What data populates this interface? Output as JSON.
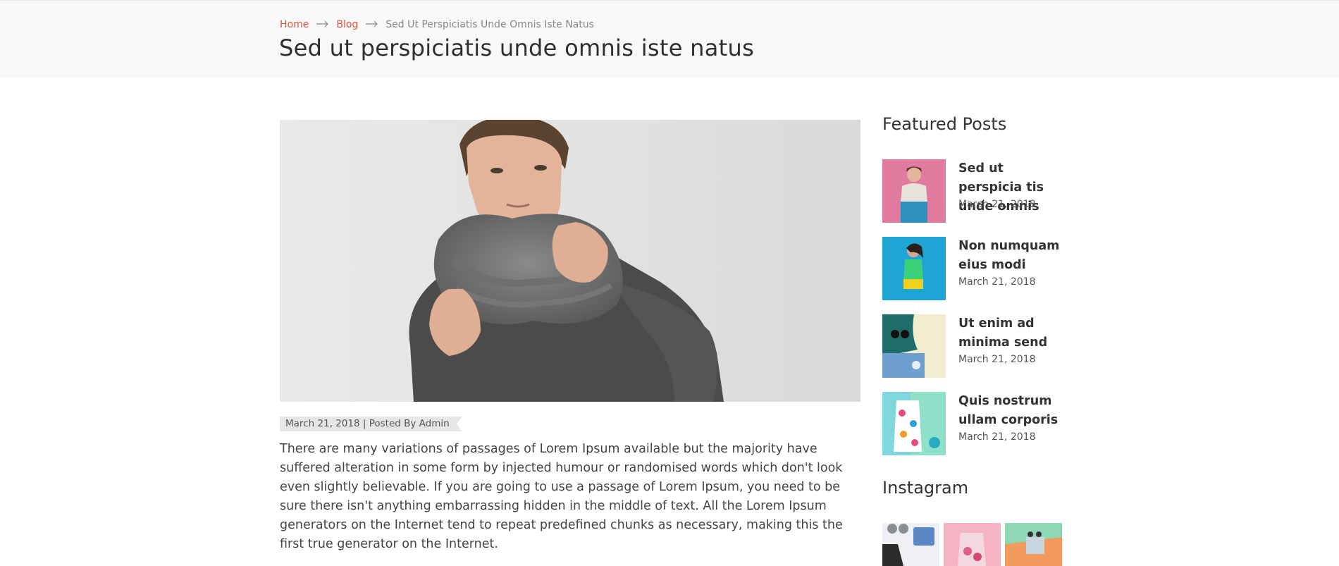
{
  "breadcrumb": {
    "home": "Home",
    "blog": "Blog",
    "current": "Sed Ut Perspiciatis Unde Omnis Iste Natus"
  },
  "page_title": "Sed ut perspiciatis unde omnis iste natus",
  "article": {
    "meta": "March 21, 2018 | Posted By Admin",
    "body": "There are many variations of passages of Lorem Ipsum available but the majority have suffered alteration in some form by injected humour or randomised words which don't look even slightly believable. If you are going to use a passage of Lorem Ipsum, you need to be sure there isn't anything embarrassing hidden in the middle of text. All the Lorem Ipsum generators on the Internet tend to repeat predefined chunks as necessary, making this the first true generator on the Internet."
  },
  "sidebar": {
    "featured_title": "Featured Posts",
    "featured": [
      {
        "title": "Sed ut perspicia tis unde omnis",
        "date": "March 21, 2018"
      },
      {
        "title": "Non numquam eius modi",
        "date": "March 21, 2018"
      },
      {
        "title": "Ut enim ad minima send",
        "date": "March 21, 2018"
      },
      {
        "title": "Quis nostrum ullam corporis",
        "date": "March 21, 2018"
      }
    ],
    "instagram_title": "Instagram"
  },
  "colors": {
    "accent": "#e0523e",
    "header_bg": "#f8f8f8",
    "meta_bg": "#e6e6e6"
  }
}
